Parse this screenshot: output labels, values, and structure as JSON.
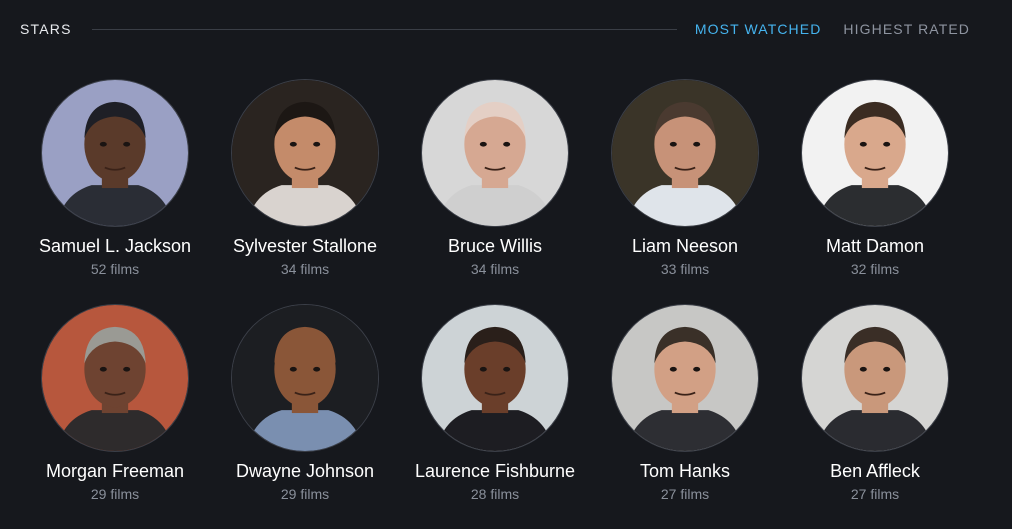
{
  "section": {
    "title": "STARS",
    "tabs": [
      {
        "label": "MOST WATCHED",
        "active": true
      },
      {
        "label": "HIGHEST RATED",
        "active": false
      }
    ]
  },
  "stars": [
    {
      "name": "Samuel L. Jackson",
      "films": "52 films",
      "bg": "#9aa0c4",
      "skin": "#5a3a2a",
      "hair": "#1e1f26",
      "shirt": "#2a2d35"
    },
    {
      "name": "Sylvester Stallone",
      "films": "34 films",
      "bg": "#2a2420",
      "skin": "#c48b6a",
      "hair": "#1c1714",
      "shirt": "#d9d3cf"
    },
    {
      "name": "Bruce Willis",
      "films": "34 films",
      "bg": "#d7d7d7",
      "skin": "#d6a892",
      "hair": "#e4cfc5",
      "shirt": "#cfcfcf"
    },
    {
      "name": "Liam Neeson",
      "films": "33 films",
      "bg": "#3a3428",
      "skin": "#c79278",
      "hair": "#4a3a30",
      "shirt": "#dfe4ea"
    },
    {
      "name": "Matt Damon",
      "films": "32 films",
      "bg": "#f2f2f2",
      "skin": "#d9a88c",
      "hair": "#3b2c22",
      "shirt": "#2b2d30"
    },
    {
      "name": "Morgan Freeman",
      "films": "29 films",
      "bg": "#b7573d",
      "skin": "#6e4331",
      "hair": "#9a9a94",
      "shirt": "#2e2b2c"
    },
    {
      "name": "Dwayne Johnson",
      "films": "29 films",
      "bg": "#1c1e22",
      "skin": "#8a5638",
      "hair": "#8a5638",
      "shirt": "#7a8fb0"
    },
    {
      "name": "Laurence Fishburne",
      "films": "28 films",
      "bg": "#cdd3d6",
      "skin": "#6a3e2a",
      "hair": "#2a1f1a",
      "shirt": "#1d1d22"
    },
    {
      "name": "Tom Hanks",
      "films": "27 films",
      "bg": "#c7c7c5",
      "skin": "#d2a085",
      "hair": "#3a3028",
      "shirt": "#2d2e33"
    },
    {
      "name": "Ben Affleck",
      "films": "27 films",
      "bg": "#d5d5d3",
      "skin": "#c9987b",
      "hair": "#3a2e26",
      "shirt": "#2a2b30"
    }
  ]
}
